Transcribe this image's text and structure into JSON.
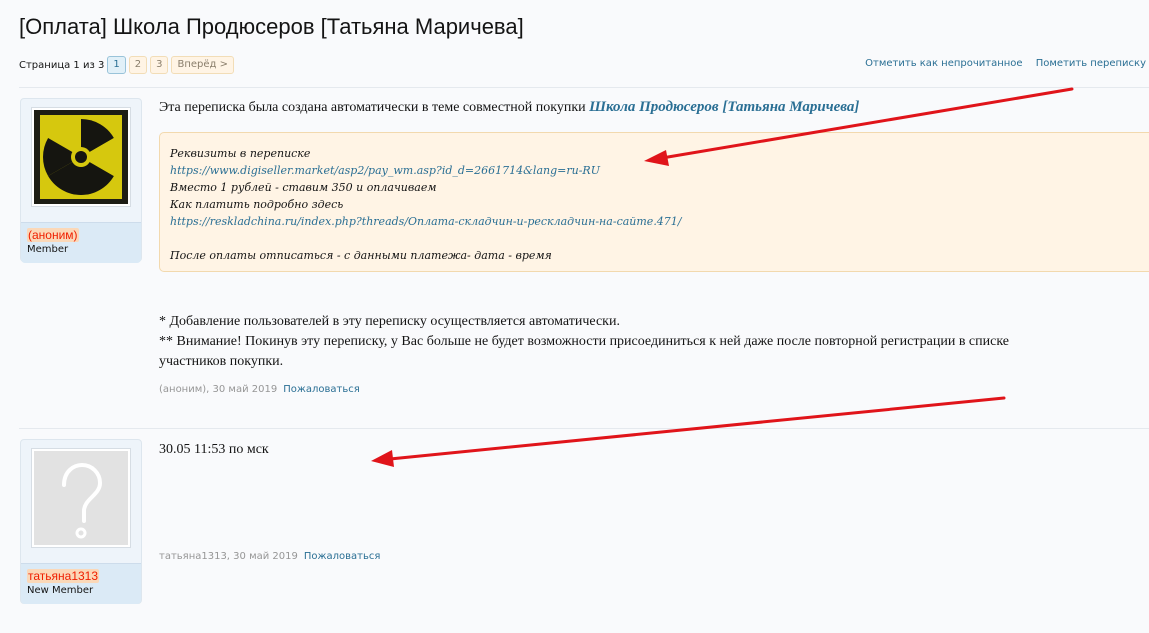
{
  "page": {
    "title": "[Оплата] Школа Продюсеров [Татьяна Маричева]"
  },
  "pagination": {
    "label": "Страница 1 из 3",
    "pages": [
      "1",
      "2",
      "3"
    ],
    "current": "1",
    "next_label": "Вперёд >"
  },
  "top_links": {
    "mark_unread": "Отметить как непрочитанное",
    "mark_conversation": "Пометить переписку"
  },
  "posts": [
    {
      "username": "(аноним)",
      "user_title": "Member",
      "intro_text": "Эта переписка была создана автоматически в теме совместной покупки",
      "thread_link": "Школа Продюсеров [Татьяна Маричева]",
      "quote_lines": [
        "Реквизиты в переписке",
        "https://www.digiseller.market/asp2/pay_wm.asp?id_d=2661714&lang=ru-RU",
        "Вместо 1 рублей - ставим 350 и оплачиваем",
        "Как платить подробно здесь",
        "https://reskladchina.ru/index.php?threads/Оплата-складчин-и-рескладчин-на-сайте.471/",
        "",
        "После оплаты отписаться - с данными платежа- дата - время"
      ],
      "notes": [
        "* Добавление пользователей в эту переписку осуществляется автоматически.",
        "** Внимание! Покинув эту переписку, у Вас больше не будет возможности присоединиться к ней даже после повторной регистрации в списке",
        "участников покупки."
      ],
      "meta": "(аноним), 30 май 2019",
      "report_label": "Пожаловаться"
    },
    {
      "username": "татьяна1313",
      "user_title": "New Member",
      "text": "30.05 11:53 по мск",
      "meta": "татьяна1313, 30 май 2019",
      "report_label": "Пожаловаться"
    }
  ],
  "colors": {
    "link": "#2a6f94",
    "username": "#ef1f00",
    "quote_bg": "#fff4e5",
    "arrow": "#e0141a"
  },
  "icons": {
    "avatar_1": "radiation-icon",
    "avatar_2": "question-mark-icon"
  }
}
